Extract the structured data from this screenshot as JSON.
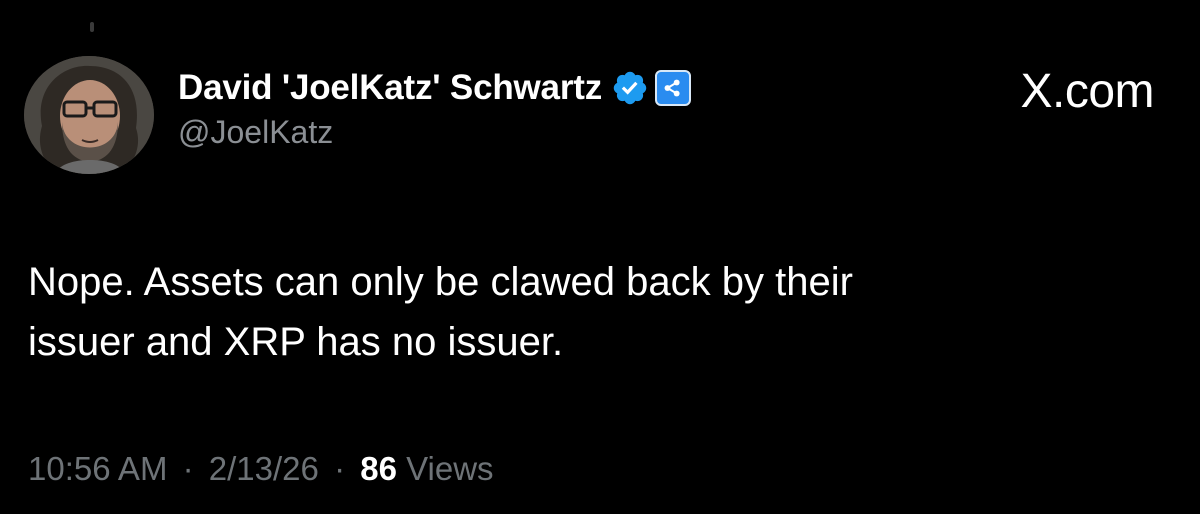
{
  "site": {
    "watermark": "X.com"
  },
  "author": {
    "display_name": "David 'JoelKatz' Schwartz",
    "handle": "@JoelKatz",
    "verified_icon": "verified-check-icon",
    "affiliate_icon": "ripple-logo-icon",
    "avatar_icon": "profile-avatar"
  },
  "tweet": {
    "lines": [
      "Nope. Assets can only be clawed back by their",
      "issuer and XRP has no issuer."
    ]
  },
  "meta": {
    "time": "10:56 AM",
    "separator": "·",
    "date": "2/13/26",
    "views_count": "86",
    "views_label": "Views"
  },
  "colors": {
    "background": "#000000",
    "text_primary": "#ffffff",
    "text_secondary": "#8b8f94",
    "verified_blue": "#1d9bf0",
    "affiliate_blue": "#2a8cf0"
  }
}
